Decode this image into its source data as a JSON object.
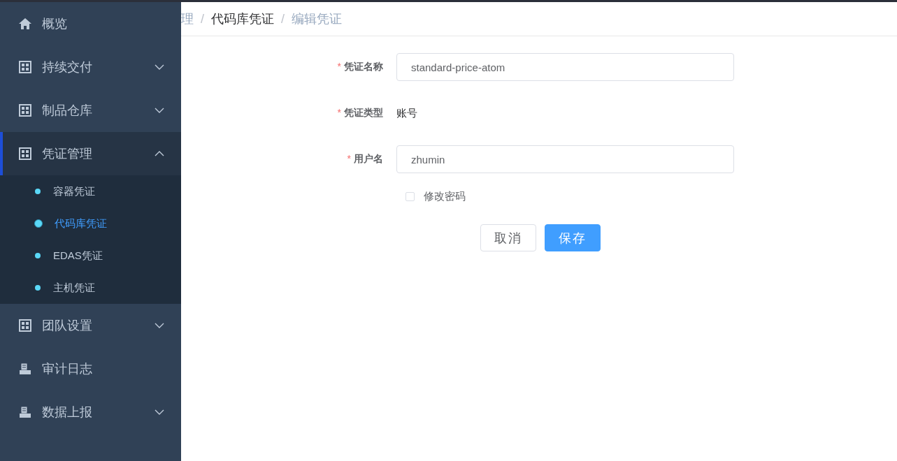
{
  "sidebar": {
    "items": [
      {
        "label": "概览",
        "kind": "home",
        "selected": false
      },
      {
        "label": "持续交付",
        "kind": "group",
        "expanded": false,
        "selected": false
      },
      {
        "label": "制品仓库",
        "kind": "group",
        "expanded": false,
        "selected": false
      },
      {
        "label": "凭证管理",
        "kind": "group",
        "expanded": true,
        "selected": true,
        "children": [
          {
            "label": "容器凭证",
            "selected": false
          },
          {
            "label": "代码库凭证",
            "selected": true
          },
          {
            "label": "EDAS凭证",
            "selected": false
          },
          {
            "label": "主机凭证",
            "selected": false
          }
        ]
      },
      {
        "label": "团队设置",
        "kind": "group",
        "expanded": false,
        "selected": false
      },
      {
        "label": "审计日志",
        "kind": "log",
        "selected": false
      },
      {
        "label": "数据上报",
        "kind": "log-group",
        "expanded": false,
        "selected": false
      }
    ]
  },
  "breadcrumb": [
    {
      "label": "理",
      "muted": true
    },
    {
      "label": "代码库凭证",
      "muted": false
    },
    {
      "label": "编辑凭证",
      "muted": true
    }
  ],
  "separator": "/",
  "form": {
    "fields": [
      {
        "label": "凭证名称",
        "required_mark": "*",
        "kind": "input",
        "value": "standard-price-atom"
      },
      {
        "label": "凭证类型",
        "required_mark": "*",
        "kind": "text",
        "value": "账号"
      },
      {
        "label": "用户名",
        "required_mark": "*",
        "kind": "input",
        "value": "zhumin"
      }
    ],
    "checkbox": {
      "label": "修改密码",
      "checked": false
    },
    "buttons": [
      {
        "label": "取消",
        "kind": "default"
      },
      {
        "label": "保存",
        "kind": "primary"
      }
    ]
  }
}
